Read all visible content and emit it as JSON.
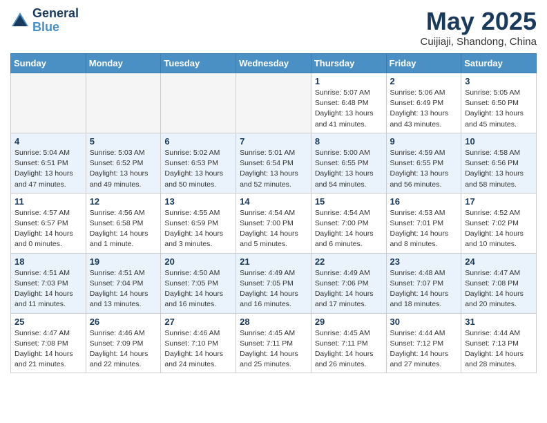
{
  "header": {
    "logo_general": "General",
    "logo_blue": "Blue",
    "month_title": "May 2025",
    "subtitle": "Cuijiaji, Shandong, China"
  },
  "weekdays": [
    "Sunday",
    "Monday",
    "Tuesday",
    "Wednesday",
    "Thursday",
    "Friday",
    "Saturday"
  ],
  "weeks": [
    {
      "days": [
        {
          "num": "",
          "info": ""
        },
        {
          "num": "",
          "info": ""
        },
        {
          "num": "",
          "info": ""
        },
        {
          "num": "",
          "info": ""
        },
        {
          "num": "1",
          "info": "Sunrise: 5:07 AM\nSunset: 6:48 PM\nDaylight: 13 hours\nand 41 minutes."
        },
        {
          "num": "2",
          "info": "Sunrise: 5:06 AM\nSunset: 6:49 PM\nDaylight: 13 hours\nand 43 minutes."
        },
        {
          "num": "3",
          "info": "Sunrise: 5:05 AM\nSunset: 6:50 PM\nDaylight: 13 hours\nand 45 minutes."
        }
      ]
    },
    {
      "days": [
        {
          "num": "4",
          "info": "Sunrise: 5:04 AM\nSunset: 6:51 PM\nDaylight: 13 hours\nand 47 minutes."
        },
        {
          "num": "5",
          "info": "Sunrise: 5:03 AM\nSunset: 6:52 PM\nDaylight: 13 hours\nand 49 minutes."
        },
        {
          "num": "6",
          "info": "Sunrise: 5:02 AM\nSunset: 6:53 PM\nDaylight: 13 hours\nand 50 minutes."
        },
        {
          "num": "7",
          "info": "Sunrise: 5:01 AM\nSunset: 6:54 PM\nDaylight: 13 hours\nand 52 minutes."
        },
        {
          "num": "8",
          "info": "Sunrise: 5:00 AM\nSunset: 6:55 PM\nDaylight: 13 hours\nand 54 minutes."
        },
        {
          "num": "9",
          "info": "Sunrise: 4:59 AM\nSunset: 6:55 PM\nDaylight: 13 hours\nand 56 minutes."
        },
        {
          "num": "10",
          "info": "Sunrise: 4:58 AM\nSunset: 6:56 PM\nDaylight: 13 hours\nand 58 minutes."
        }
      ]
    },
    {
      "days": [
        {
          "num": "11",
          "info": "Sunrise: 4:57 AM\nSunset: 6:57 PM\nDaylight: 14 hours\nand 0 minutes."
        },
        {
          "num": "12",
          "info": "Sunrise: 4:56 AM\nSunset: 6:58 PM\nDaylight: 14 hours\nand 1 minute."
        },
        {
          "num": "13",
          "info": "Sunrise: 4:55 AM\nSunset: 6:59 PM\nDaylight: 14 hours\nand 3 minutes."
        },
        {
          "num": "14",
          "info": "Sunrise: 4:54 AM\nSunset: 7:00 PM\nDaylight: 14 hours\nand 5 minutes."
        },
        {
          "num": "15",
          "info": "Sunrise: 4:54 AM\nSunset: 7:00 PM\nDaylight: 14 hours\nand 6 minutes."
        },
        {
          "num": "16",
          "info": "Sunrise: 4:53 AM\nSunset: 7:01 PM\nDaylight: 14 hours\nand 8 minutes."
        },
        {
          "num": "17",
          "info": "Sunrise: 4:52 AM\nSunset: 7:02 PM\nDaylight: 14 hours\nand 10 minutes."
        }
      ]
    },
    {
      "days": [
        {
          "num": "18",
          "info": "Sunrise: 4:51 AM\nSunset: 7:03 PM\nDaylight: 14 hours\nand 11 minutes."
        },
        {
          "num": "19",
          "info": "Sunrise: 4:51 AM\nSunset: 7:04 PM\nDaylight: 14 hours\nand 13 minutes."
        },
        {
          "num": "20",
          "info": "Sunrise: 4:50 AM\nSunset: 7:05 PM\nDaylight: 14 hours\nand 16 minutes."
        },
        {
          "num": "21",
          "info": "Sunrise: 4:49 AM\nSunset: 7:05 PM\nDaylight: 14 hours\nand 16 minutes."
        },
        {
          "num": "22",
          "info": "Sunrise: 4:49 AM\nSunset: 7:06 PM\nDaylight: 14 hours\nand 17 minutes."
        },
        {
          "num": "23",
          "info": "Sunrise: 4:48 AM\nSunset: 7:07 PM\nDaylight: 14 hours\nand 18 minutes."
        },
        {
          "num": "24",
          "info": "Sunrise: 4:47 AM\nSunset: 7:08 PM\nDaylight: 14 hours\nand 20 minutes."
        }
      ]
    },
    {
      "days": [
        {
          "num": "25",
          "info": "Sunrise: 4:47 AM\nSunset: 7:08 PM\nDaylight: 14 hours\nand 21 minutes."
        },
        {
          "num": "26",
          "info": "Sunrise: 4:46 AM\nSunset: 7:09 PM\nDaylight: 14 hours\nand 22 minutes."
        },
        {
          "num": "27",
          "info": "Sunrise: 4:46 AM\nSunset: 7:10 PM\nDaylight: 14 hours\nand 24 minutes."
        },
        {
          "num": "28",
          "info": "Sunrise: 4:45 AM\nSunset: 7:11 PM\nDaylight: 14 hours\nand 25 minutes."
        },
        {
          "num": "29",
          "info": "Sunrise: 4:45 AM\nSunset: 7:11 PM\nDaylight: 14 hours\nand 26 minutes."
        },
        {
          "num": "30",
          "info": "Sunrise: 4:44 AM\nSunset: 7:12 PM\nDaylight: 14 hours\nand 27 minutes."
        },
        {
          "num": "31",
          "info": "Sunrise: 4:44 AM\nSunset: 7:13 PM\nDaylight: 14 hours\nand 28 minutes."
        }
      ]
    }
  ]
}
